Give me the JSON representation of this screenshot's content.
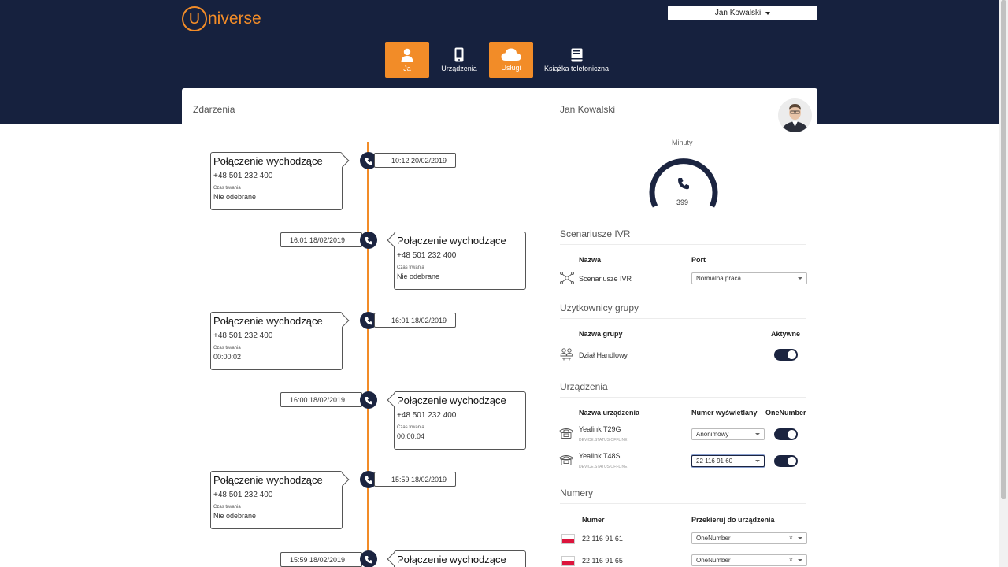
{
  "app": {
    "logo_letter": "U",
    "logo_rest": "niverse",
    "user_name": "Jan Kowalski"
  },
  "nav": [
    {
      "label": "Ja",
      "icon": "person-icon",
      "active": true
    },
    {
      "label": "Urządzenia",
      "icon": "phone-device-icon",
      "active": false
    },
    {
      "label": "Usługi",
      "icon": "cloud-icon",
      "active": true
    },
    {
      "label": "Książka telefoniczna",
      "icon": "book-icon",
      "active": false
    }
  ],
  "events": {
    "title": "Zdarzenia",
    "items": [
      {
        "title": "Połączenie wychodzące",
        "number": "+48 501 232 400",
        "duration_label": "Czas trwania",
        "duration": "Nie odebrane",
        "datetime": "10:12 20/02/2019"
      },
      {
        "title": "Połączenie wychodzące",
        "number": "+48 501 232 400",
        "duration_label": "Czas trwania",
        "duration": "Nie odebrane",
        "datetime": "16:01 18/02/2019"
      },
      {
        "title": "Połączenie wychodzące",
        "number": "+48 501 232 400",
        "duration_label": "Czas trwania",
        "duration": "00:00:02",
        "datetime": "16:01 18/02/2019"
      },
      {
        "title": "Połączenie wychodzące",
        "number": "+48 501 232 400",
        "duration_label": "Czas trwania",
        "duration": "00:00:04",
        "datetime": "16:00 18/02/2019"
      },
      {
        "title": "Połączenie wychodzące",
        "number": "+48 501 232 400",
        "duration_label": "Czas trwania",
        "duration": "Nie odebrane",
        "datetime": "15:59 18/02/2019"
      },
      {
        "title": "Połączenie wychodzące",
        "number": "",
        "duration_label": "",
        "duration": "",
        "datetime": "15:59 18/02/2019"
      }
    ]
  },
  "profile": {
    "name": "Jan Kowalski",
    "gauge": {
      "label": "Minuty",
      "value": "399"
    }
  },
  "ivr": {
    "title": "Scenariusze IVR",
    "col_name": "Nazwa",
    "col_port": "Port",
    "row_name": "Scenariusze IVR",
    "row_port": "Normalna praca"
  },
  "groups": {
    "title": "Użytkownicy grupy",
    "col_name": "Nazwa grupy",
    "col_active": "Aktywne",
    "row_name": "Dział Handlowy",
    "row_active": true
  },
  "devices": {
    "title": "Urządzenia",
    "col_name": "Nazwa urządzenia",
    "col_display": "Numer wyświetlany",
    "col_one": "OneNumber",
    "rows": [
      {
        "name": "Yealink T29G",
        "status": "DEVICE.STATUS.OFFLINE",
        "display": "Anonimowy",
        "one": true
      },
      {
        "name": "Yealink T48S",
        "status": "DEVICE.STATUS.OFFLINE",
        "display": "22 116 91 60",
        "one": true
      }
    ]
  },
  "numbers": {
    "title": "Numery",
    "col_number": "Numer",
    "col_redirect": "Przekieruj do urządzenia",
    "rows": [
      {
        "number": "22 116 91 61",
        "redirect": "OneNumber",
        "clear": "×"
      },
      {
        "number": "22 116 91 65",
        "redirect": "OneNumber",
        "clear": "×"
      }
    ]
  },
  "colors": {
    "navy": "#16213e",
    "orange": "#f28c28"
  }
}
